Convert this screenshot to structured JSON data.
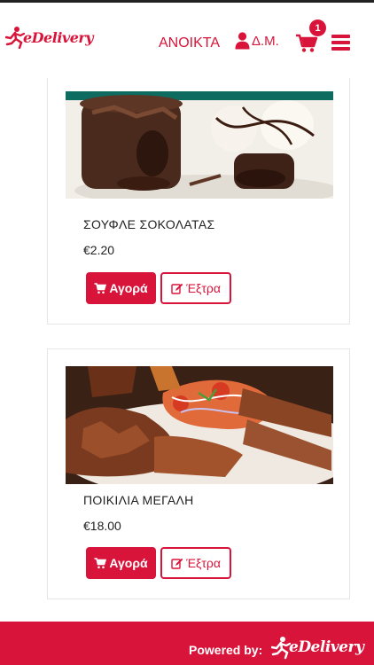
{
  "header": {
    "brand": "eDelivery",
    "status": "ΑΝΟΙΚΤΑ",
    "account_label": "Δ.Μ.",
    "cart_count": "1"
  },
  "products": [
    {
      "name": "ΣΟΥΦΛΕ ΣΟΚΟΛΑΤΑΣ",
      "price": "€2.20",
      "buy_label": "Αγορά",
      "extra_label": "Έξτρα"
    },
    {
      "name": "ΠΟΙΚΙΛΙΑ ΜΕΓΑΛΗ",
      "price": "€18.00",
      "buy_label": "Αγορά",
      "extra_label": "Έξτρα"
    }
  ],
  "footer": {
    "powered_by": "Powered by:",
    "brand": "eDelivery"
  },
  "colors": {
    "accent": "#d8143a"
  },
  "icons": [
    "runner-logo-icon",
    "user-icon",
    "cart-icon",
    "menu-icon",
    "edit-icon"
  ]
}
